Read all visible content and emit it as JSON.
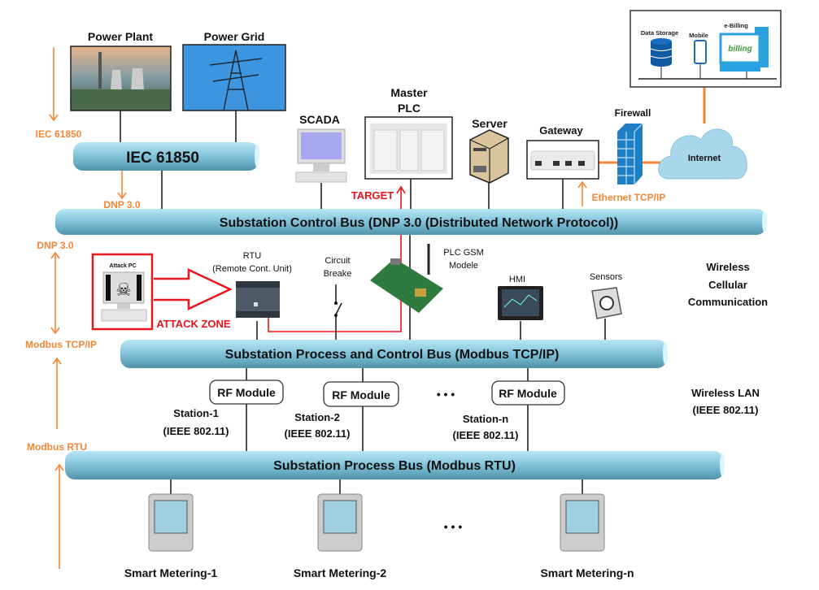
{
  "colors": {
    "bus": "#7fc4dc",
    "orange": "#f58634",
    "attack_red": "#e8141c",
    "firewall": "#1f7fc4",
    "cloud": "#a9d7ea"
  },
  "sources": {
    "power_plant": "Power Plant",
    "power_grid": "Power Grid"
  },
  "buses": {
    "iec": "IEC 61850",
    "control": "Substation Control Bus (DNP 3.0 (Distributed Network Protocol))",
    "process_control": "Substation Process and Control Bus (Modbus TCP/IP)",
    "process": "Substation Process Bus (Modbus RTU)"
  },
  "protocol_labels": {
    "iec": "IEC 61850",
    "dnp_mid": "DNP 3.0",
    "dnp_left": "DNP 3.0",
    "modbus_tcp": "Modbus TCP/IP",
    "modbus_rtu": "Modbus RTU",
    "ethernet": "Ethernet TCP/IP"
  },
  "control_devices": {
    "scada": "SCADA",
    "master_plc_1": "Master",
    "master_plc_2": "PLC",
    "target": "TARGET",
    "server": "Server",
    "gateway": "Gateway",
    "firewall": "Firewall",
    "internet": "Internet"
  },
  "cloud_services": {
    "data_storage": "Data Storage",
    "mobile": "Mobile",
    "ebilling": "e-Billing",
    "billing_logo": "billing"
  },
  "field_devices": {
    "attack_pc": "Attack PC",
    "attack_zone": "ATTACK ZONE",
    "rtu_1": "RTU",
    "rtu_2": "(Remote Cont. Unit)",
    "breaker_1": "Circuit",
    "breaker_2": "Breake",
    "gsm_1": "PLC GSM",
    "gsm_2": "Modele",
    "hmi": "HMI",
    "sensors": "Sensors",
    "wireless_1": "Wireless",
    "wireless_2": "Cellular",
    "wireless_3": "Communication"
  },
  "stations": [
    {
      "rf": "RF Module",
      "name": "Station-1",
      "std": "(IEEE 802.11)"
    },
    {
      "rf": "RF Module",
      "name": "Station-2",
      "std": "(IEEE 802.11)"
    },
    {
      "rf": "RF Module",
      "name": "Station-n",
      "std": "(IEEE 802.11)"
    }
  ],
  "ellipsis": "• • •",
  "wireless_lan_1": "Wireless LAN",
  "wireless_lan_2": "(IEEE 802.11)",
  "meters": [
    "Smart Metering-1",
    "Smart Metering-2",
    "Smart Metering-n"
  ]
}
